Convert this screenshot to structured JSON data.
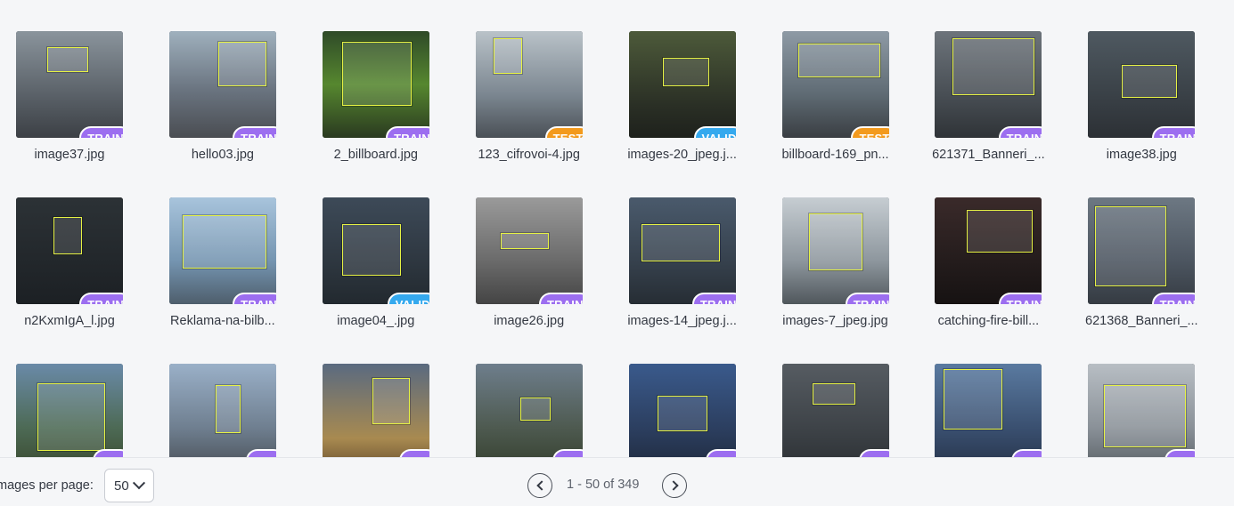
{
  "images": [
    {
      "name": "image37.jpg",
      "split": "TRAIN"
    },
    {
      "name": "hello03.jpg",
      "split": "TRAIN"
    },
    {
      "name": "2_billboard.jpg",
      "split": "TRAIN"
    },
    {
      "name": "123_cifrovoi-4.jpg",
      "split": "TEST"
    },
    {
      "name": "images-20_jpeg.j...",
      "split": "VALID"
    },
    {
      "name": "billboard-169_pn...",
      "split": "TEST"
    },
    {
      "name": "621371_Banneri_...",
      "split": "TRAIN"
    },
    {
      "name": "image38.jpg",
      "split": "TRAIN"
    },
    {
      "name": "n2KxmIgA_l.jpg",
      "split": "TRAIN"
    },
    {
      "name": "Reklama-na-bilb...",
      "split": "TRAIN"
    },
    {
      "name": "image04_.jpg",
      "split": "VALID"
    },
    {
      "name": "image26.jpg",
      "split": "TRAIN"
    },
    {
      "name": "images-14_jpeg.j...",
      "split": "TRAIN"
    },
    {
      "name": "images-7_jpeg.jpg",
      "split": "TRAIN"
    },
    {
      "name": "catching-fire-bill...",
      "split": "TRAIN"
    },
    {
      "name": "621368_Banneri_...",
      "split": "TRAIN"
    },
    {
      "name": "",
      "split": ""
    },
    {
      "name": "",
      "split": ""
    },
    {
      "name": "",
      "split": ""
    },
    {
      "name": "",
      "split": ""
    },
    {
      "name": "",
      "split": ""
    },
    {
      "name": "",
      "split": ""
    },
    {
      "name": "",
      "split": ""
    },
    {
      "name": "",
      "split": ""
    }
  ],
  "footer": {
    "per_page_label": "Images per page:",
    "per_page_value": "50",
    "range_text": "1 - 50 of 349"
  },
  "colors": {
    "train": "#9c6ef0",
    "test": "#f39a1d",
    "valid": "#35a9ee",
    "box": "#e6f244"
  }
}
